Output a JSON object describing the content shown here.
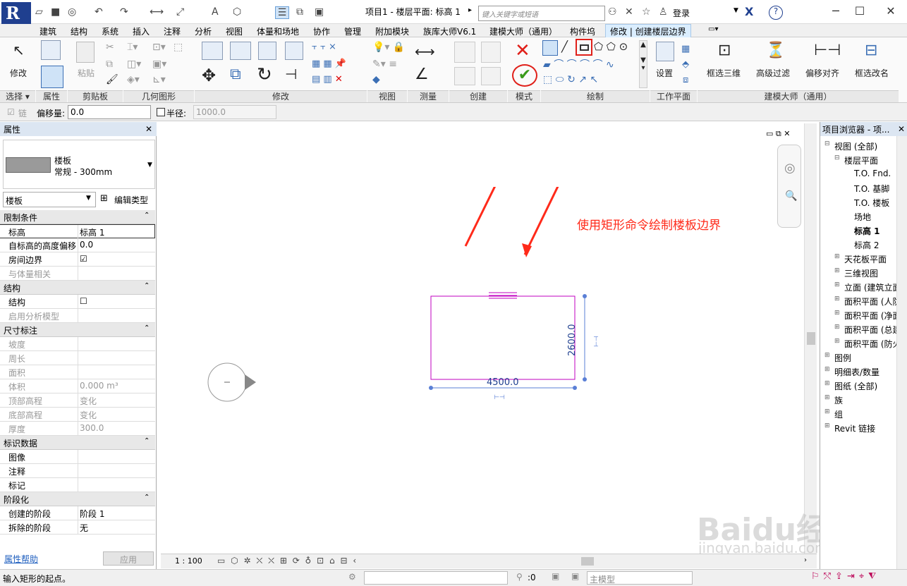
{
  "app": {
    "title": "项目1 - 楼层平面: 标高 1",
    "search_placeholder": "键入关键字或短语",
    "login": "登录"
  },
  "tabs": [
    "建筑",
    "结构",
    "系统",
    "插入",
    "注释",
    "分析",
    "视图",
    "体量和场地",
    "协作",
    "管理",
    "附加模块",
    "族库大师V6.1",
    "建模大师（通用）",
    "构件坞",
    "修改 | 创建楼层边界"
  ],
  "ribbon": {
    "modify_label": "修改",
    "paste_label": "粘贴",
    "view_label": "视图",
    "measure_label": "测量",
    "create_label": "创建",
    "mode_label": "模式",
    "draw_label": "绘制",
    "workplane_label": "工作平面",
    "set_label": "设置",
    "jmds_label": "建模大师（通用）",
    "jmds_buttons": [
      "框选三维",
      "高级过滤",
      "偏移对齐",
      "框选改名"
    ],
    "panels": [
      "选择 ▾",
      "属性",
      "剪贴板",
      "几何图形",
      "修改"
    ]
  },
  "optionsbar": {
    "chain_label": "链",
    "offset_label": "偏移量:",
    "offset_value": "0.0",
    "radius_label": "半径:",
    "radius_value": "1000.0"
  },
  "properties": {
    "header": "属性",
    "family": "楼板",
    "type": "常规 - 300mm",
    "selector": "楼板",
    "edit_type": "编辑类型",
    "groups": [
      {
        "name": "限制条件",
        "rows": [
          [
            "标高",
            "标高 1"
          ],
          [
            "自标高的高度偏移",
            "0.0"
          ],
          [
            "房间边界",
            "☑"
          ],
          [
            "与体量相关",
            ""
          ]
        ]
      },
      {
        "name": "结构",
        "rows": [
          [
            "结构",
            "☐"
          ],
          [
            "启用分析模型",
            ""
          ]
        ]
      },
      {
        "name": "尺寸标注",
        "rows": [
          [
            "坡度",
            ""
          ],
          [
            "周长",
            ""
          ],
          [
            "面积",
            ""
          ],
          [
            "体积",
            "0.000 m³"
          ],
          [
            "顶部高程",
            "变化"
          ],
          [
            "底部高程",
            "变化"
          ],
          [
            "厚度",
            "300.0"
          ]
        ]
      },
      {
        "name": "标识数据",
        "rows": [
          [
            "图像",
            ""
          ],
          [
            "注释",
            ""
          ],
          [
            "标记",
            ""
          ]
        ]
      },
      {
        "name": "阶段化",
        "rows": [
          [
            "创建的阶段",
            "阶段 1"
          ],
          [
            "拆除的阶段",
            "无"
          ]
        ]
      }
    ],
    "help": "属性帮助",
    "apply": "应用"
  },
  "canvas": {
    "annotation": "使用矩形命令绘制楼板边界",
    "dim_width": "4500.0",
    "dim_height": "2600.0",
    "scale": "1 : 100"
  },
  "browser": {
    "header": "项目浏览器 - 项...",
    "items": [
      "视图 (全部)",
      "楼层平面",
      "T.O. Fnd.",
      "T.O. 基脚",
      "T.O. 楼板",
      "场地",
      "标高 1",
      "标高 2",
      "天花板平面",
      "三维视图",
      "立面 (建筑立面)",
      "面积平面 (人防)",
      "面积平面 (净面)",
      "面积平面 (总建)",
      "面积平面 (防火)",
      "图例",
      "明细表/数量",
      "图纸 (全部)",
      "族",
      "组",
      "Revit 链接"
    ]
  },
  "status": {
    "prompt": "输入矩形的起点。",
    "zero": ":0",
    "model": "主模型"
  },
  "watermark": {
    "text": "Baidu经验",
    "url": "jingyan.baidu.com"
  },
  "colors": {
    "accent": "#1f3f8f",
    "boundary": "#c000c0",
    "arrow": "#ff2a1a",
    "dim": "#1f3f8f"
  }
}
